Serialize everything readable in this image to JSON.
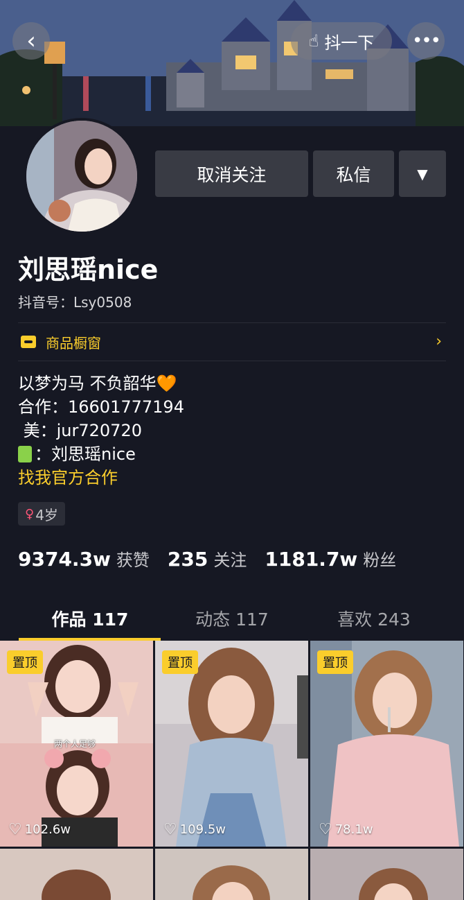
{
  "header": {
    "back_icon": "chevron-left-icon",
    "shake_label": "抖一下",
    "shake_icon": "hand-point-icon",
    "more_icon": "more-dots-icon"
  },
  "profile": {
    "name": "刘思瑶nice",
    "douyin_id": "抖音号：Lsy0508",
    "unfollow_label": "取消关注",
    "message_label": "私信",
    "dropdown_icon": "triangle-down-icon"
  },
  "shop": {
    "label": "商品橱窗",
    "icon": "shop-icon",
    "chevron": "›"
  },
  "bio": {
    "line1": "以梦为马 不负韶华",
    "line1_emoji": "🧡",
    "line2": "合作：16601777194",
    "line3": " 美：jur720720",
    "line4": "：刘思瑶nice",
    "line5": "找我官方合作"
  },
  "tag": {
    "age": "4岁",
    "gender_icon": "female-icon"
  },
  "stats": {
    "likes_num": "9374.3w",
    "likes_label": "获赞",
    "following_num": "235",
    "following_label": "关注",
    "followers_num": "1181.7w",
    "followers_label": "粉丝"
  },
  "tabs": [
    {
      "label": "作品 117"
    },
    {
      "label": "动态 117"
    },
    {
      "label": "喜欢 243"
    }
  ],
  "videos": [
    {
      "pin": "置顶",
      "likes": "102.6w",
      "caption": "两个人足够"
    },
    {
      "pin": "置顶",
      "likes": "109.5w"
    },
    {
      "pin": "置顶",
      "likes": "78.1w"
    }
  ],
  "colors": {
    "accent": "#facd2c",
    "background": "#161823",
    "button": "#393b44"
  }
}
